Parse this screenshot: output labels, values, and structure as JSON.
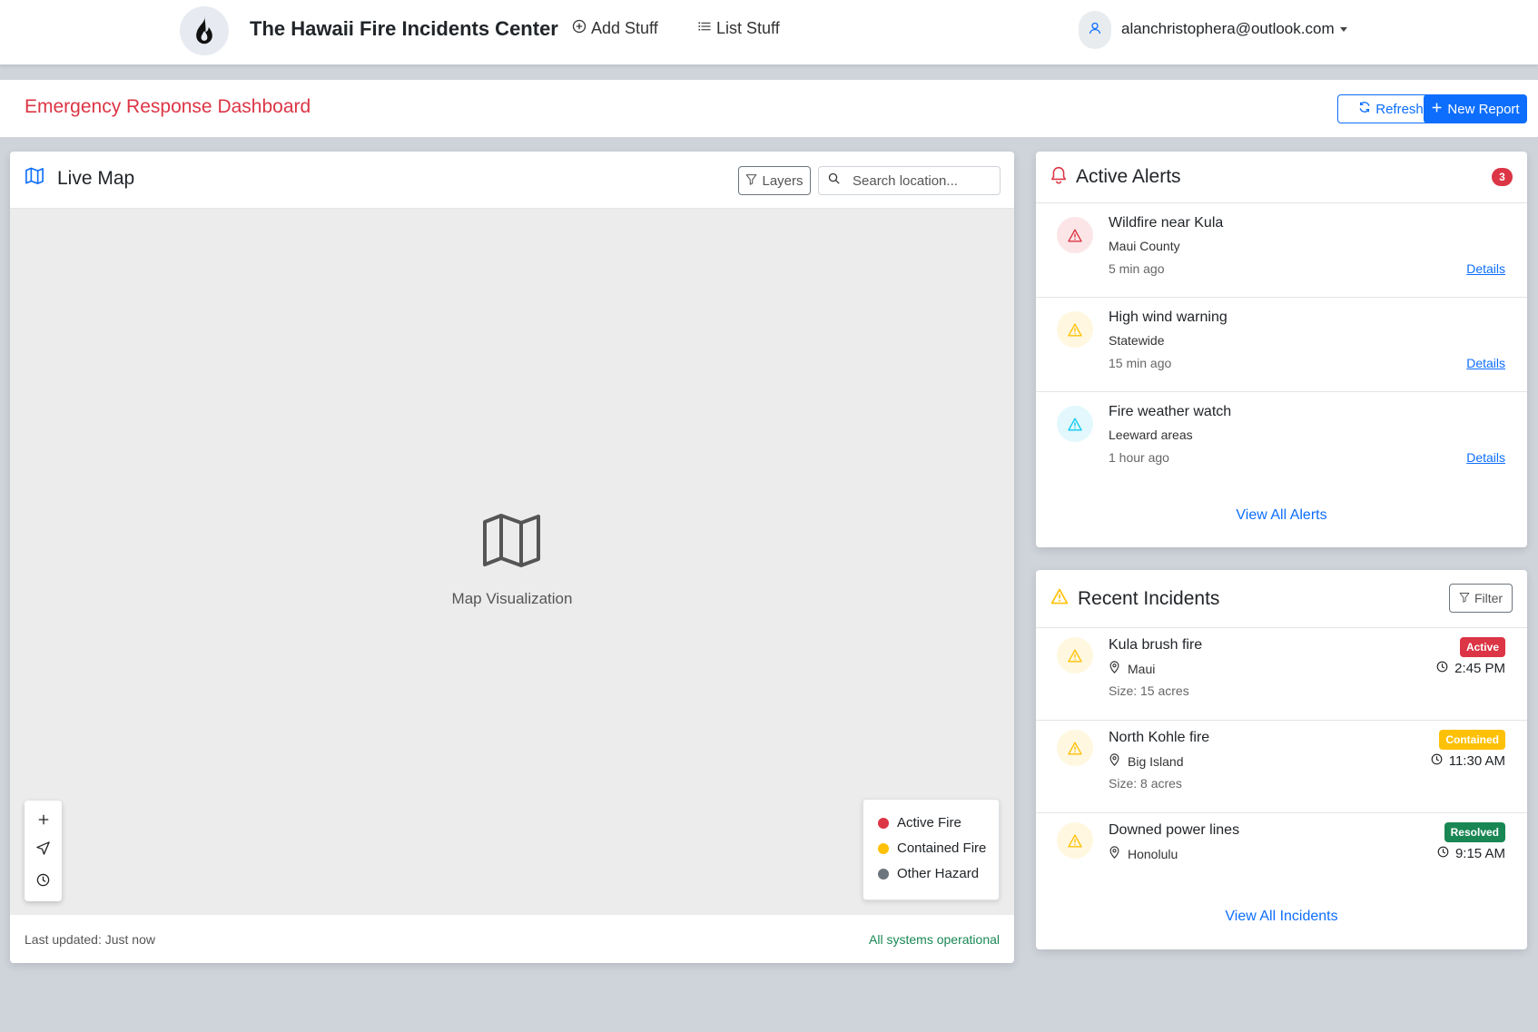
{
  "navbar": {
    "brand": "The Hawaii Fire Incidents Center",
    "links": [
      {
        "label": "Add Stuff",
        "icon": "plus-circle-icon"
      },
      {
        "label": "List Stuff",
        "icon": "list-icon"
      }
    ],
    "user_email": "alanchristophera@outlook.com"
  },
  "header": {
    "title": "Emergency Response Dashboard",
    "refresh_label": "Refresh",
    "new_report_label": "New Report"
  },
  "map": {
    "title": "Live Map",
    "layers_label": "Layers",
    "search_placeholder": "Search location...",
    "placeholder_label": "Map Visualization",
    "legend": [
      {
        "label": "Active Fire",
        "color": "#dc3545"
      },
      {
        "label": "Contained Fire",
        "color": "#ffc107"
      },
      {
        "label": "Other Hazard",
        "color": "#6c757d"
      }
    ],
    "last_updated": "Last updated: Just now",
    "status": "All systems operational"
  },
  "alerts": {
    "title": "Active Alerts",
    "count": "3",
    "items": [
      {
        "title": "Wildfire near Kula",
        "location": "Maui County",
        "time": "5 min ago",
        "link": "Details",
        "color": "#dc3545",
        "bg": "#fbe5e7"
      },
      {
        "title": "High wind warning",
        "location": "Statewide",
        "time": "15 min ago",
        "link": "Details",
        "color": "#ffc107",
        "bg": "#fff7df"
      },
      {
        "title": "Fire weather watch",
        "location": "Leeward areas",
        "time": "1 hour ago",
        "link": "Details",
        "color": "#0dcaf0",
        "bg": "#e2f8fc"
      }
    ],
    "view_all": "View All Alerts"
  },
  "incidents": {
    "title": "Recent Incidents",
    "filter_label": "Filter",
    "items": [
      {
        "title": "Kula brush fire",
        "location": "Maui",
        "size": "Size: 15 acres",
        "status": "Active",
        "status_color": "#dc3545",
        "time": "2:45 PM"
      },
      {
        "title": "North Kohle fire",
        "location": "Big Island",
        "size": "Size: 8 acres",
        "status": "Contained",
        "status_color": "#ffc107",
        "time": "11:30 AM"
      },
      {
        "title": "Downed power lines",
        "location": "Honolulu",
        "status": "Resolved",
        "status_color": "#198754",
        "time": "9:15 AM"
      }
    ],
    "view_all": "View All Incidents"
  }
}
